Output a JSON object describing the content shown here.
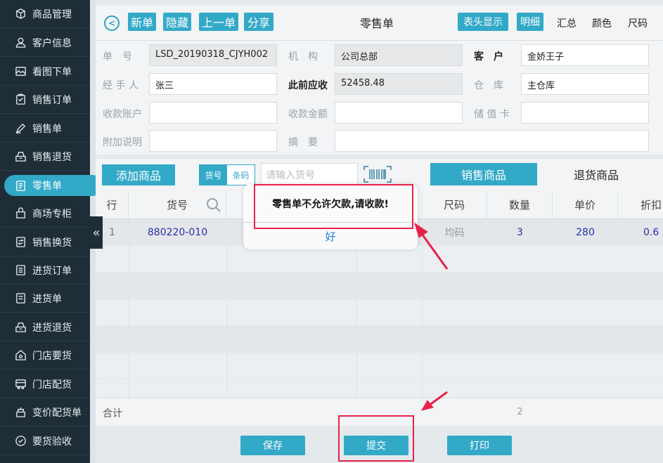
{
  "sidebar": {
    "items": [
      {
        "label": "商品管理",
        "icon": "box-icon"
      },
      {
        "label": "客户信息",
        "icon": "user-icon"
      },
      {
        "label": "看图下单",
        "icon": "image-icon"
      },
      {
        "label": "销售订单",
        "icon": "clipboard-icon"
      },
      {
        "label": "销售单",
        "icon": "pen-icon"
      },
      {
        "label": "销售退货",
        "icon": "return-icon"
      },
      {
        "label": "零售单",
        "icon": "document-icon"
      },
      {
        "label": "商场专柜",
        "icon": "shop-icon"
      },
      {
        "label": "销售换货",
        "icon": "exchange-icon"
      },
      {
        "label": "进货订单",
        "icon": "list-icon"
      },
      {
        "label": "进货单",
        "icon": "receipt-icon"
      },
      {
        "label": "进货退货",
        "icon": "return-icon"
      },
      {
        "label": "门店要货",
        "icon": "store-icon"
      },
      {
        "label": "门店配货",
        "icon": "truck-icon"
      },
      {
        "label": "变价配货单",
        "icon": "price-icon"
      },
      {
        "label": "要货验收",
        "icon": "check-icon"
      }
    ],
    "active_index": 6,
    "collapse_glyph": "«"
  },
  "toolbar": {
    "back_glyph": "<",
    "new_label": "新单",
    "hide_label": "隐藏",
    "prev_label": "上一单",
    "share_label": "分享",
    "title": "零售单",
    "header_display_label": "表头显示",
    "detail_label": "明细",
    "summary_label": "汇总",
    "color_label": "颜色",
    "size_label": "尺码"
  },
  "form": {
    "order_no_label": "单　号",
    "order_no_value": "LSD_20190318_CJYH002",
    "org_label": "机　构",
    "org_value": "公司总部",
    "customer_label": "客　户",
    "customer_value": "金娇王子",
    "handler_label": "经 手 人",
    "handler_value": "张三",
    "prev_receivable_label": "此前应收",
    "prev_receivable_value": "52458.48",
    "warehouse_label": "仓　库",
    "warehouse_value": "主仓库",
    "account_label": "收款账户",
    "amount_label": "收款金额",
    "stored_card_label": "储 值 卡",
    "remark_label": "附加说明",
    "summary_label": "摘　要"
  },
  "search": {
    "add_label": "添加商品",
    "seg_item_no": "货号",
    "seg_barcode": "条码",
    "placeholder": "请输入货号",
    "tab_sale": "销售商品",
    "tab_return": "退货商品"
  },
  "table": {
    "headers": {
      "row": "行",
      "item_no": "货号",
      "size": "尺码",
      "qty": "数量",
      "price": "单价",
      "discount": "折扣"
    },
    "rows": [
      {
        "row": "1",
        "item_no": "880220-010",
        "size": "均码",
        "qty": "3",
        "price": "280",
        "discount": "0.6"
      }
    ],
    "total_label": "合计",
    "total_qty": "2"
  },
  "bottom": {
    "save_label": "保存",
    "submit_label": "提交",
    "print_label": "打印"
  },
  "alert": {
    "message": "零售单不允许欠款,请收款!",
    "ok_label": "好"
  },
  "colors": {
    "sidebar_bg": "#1f2d36",
    "accent": "#33a9c8",
    "annotation": "#e8214a",
    "link_blue": "#1a7ee0"
  }
}
